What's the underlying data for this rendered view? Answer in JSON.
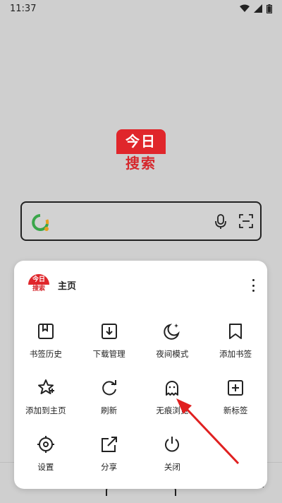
{
  "status_bar": {
    "time": "11:37"
  },
  "logo": {
    "line1": "今日",
    "line2": "搜索"
  },
  "search": {
    "placeholder": ""
  },
  "menu": {
    "header_logo_line1": "今日",
    "header_logo_line2": "搜索",
    "title": "主页",
    "items": [
      {
        "label": "书签历史",
        "icon": "bookmark-history-icon"
      },
      {
        "label": "下载管理",
        "icon": "download-icon"
      },
      {
        "label": "夜间模式",
        "icon": "night-mode-icon"
      },
      {
        "label": "添加书签",
        "icon": "add-bookmark-icon"
      },
      {
        "label": "添加到主页",
        "icon": "add-to-home-icon"
      },
      {
        "label": "刷新",
        "icon": "refresh-icon"
      },
      {
        "label": "无痕浏览",
        "icon": "incognito-icon"
      },
      {
        "label": "新标签",
        "icon": "new-tab-icon"
      },
      {
        "label": "设置",
        "icon": "settings-icon"
      },
      {
        "label": "分享",
        "icon": "share-icon"
      },
      {
        "label": "关闭",
        "icon": "power-icon"
      }
    ]
  },
  "colors": {
    "brand_red": "#e0262b",
    "annotation_red": "#e02020"
  }
}
